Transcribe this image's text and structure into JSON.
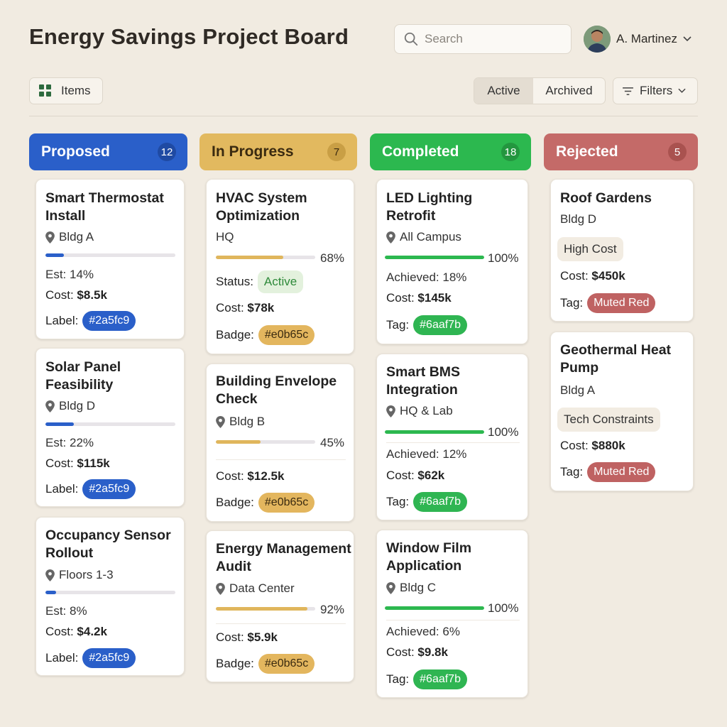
{
  "header": {
    "title": "Energy Savings Project Board",
    "search_placeholder": "Search",
    "user_name": "A. Martinez"
  },
  "toolbar": {
    "items_label": "Items",
    "view_active": "Active",
    "view_archived": "Archived",
    "filters_label": "Filters"
  },
  "colors": {
    "proposed": "#2a5fc9",
    "in_progress": "#e0b65c",
    "completed": "#6aaf7b",
    "rejected": "#c06666"
  },
  "columns": [
    {
      "title": "Proposed",
      "count": "12",
      "cards": [
        {
          "title": "Smart Thermostat Install",
          "location": "Bldg A",
          "progress": 0.14,
          "est": "Est: 14%",
          "cost_label": "Cost:",
          "cost": "$8.5k",
          "label_label": "Label:",
          "label": "#2a5fc9"
        },
        {
          "title": "Solar Panel Feasibility",
          "location": "Bldg D",
          "progress": 0.22,
          "est": "Est: 22%",
          "cost_label": "Cost:",
          "cost": "$115k",
          "label_label": "Label:",
          "label": "#2a5fc9"
        },
        {
          "title": "Occupancy Sensor Rollout",
          "location": "Floors 1-3",
          "progress": 0.08,
          "est": "Est: 8%",
          "cost_label": "Cost:",
          "cost": "$4.2k",
          "label_label": "Label:",
          "label": "#2a5fc9"
        }
      ]
    },
    {
      "title": "In Progress",
      "count": "7",
      "cards": [
        {
          "title": "HVAC System Optimization",
          "location": "HQ",
          "progress": 0.68,
          "pct": "68%",
          "status_label": "Status:",
          "status": "Active",
          "cost_label": "Cost:",
          "cost": "$78k",
          "badge_label": "Badge:",
          "badge": "#e0b65c"
        },
        {
          "title": "Building Envelope Check",
          "location": "Bldg B",
          "progress": 0.45,
          "pct": "45%",
          "cost_label": "Cost:",
          "cost": "$12.5k",
          "badge_label": "Badge:",
          "badge": "#e0b65c"
        },
        {
          "title": "Energy Management Audit",
          "location": "Data Center",
          "progress": 0.92,
          "pct": "92%",
          "cost_label": "Cost:",
          "cost": "$5.9k",
          "badge_label": "Badge:",
          "badge": "#e0b65c"
        }
      ]
    },
    {
      "title": "Completed",
      "count": "18",
      "cards": [
        {
          "title": "LED Lighting Retrofit",
          "location": "All Campus",
          "progress": 1.0,
          "pct": "100%",
          "achieved": "Achieved: 18%",
          "cost_label": "Cost:",
          "cost": "$145k",
          "tag_label": "Tag:",
          "tag": "#6aaf7b"
        },
        {
          "title": "Smart BMS Integration",
          "location": "HQ & Lab",
          "progress": 1.0,
          "pct": "100%",
          "achieved": "Achieved: 12%",
          "cost_label": "Cost:",
          "cost": "$62k",
          "tag_label": "Tag:",
          "tag": "#6aaf7b"
        },
        {
          "title": "Window Film Application",
          "location": "Bldg C",
          "progress": 1.0,
          "pct": "100%",
          "achieved": "Achieved: 6%",
          "cost_label": "Cost:",
          "cost": "$9.8k",
          "tag_label": "Tag:",
          "tag": "#6aaf7b"
        }
      ]
    },
    {
      "title": "Rejected",
      "count": "5",
      "cards": [
        {
          "title": "Roof Gardens",
          "location": "Bldg D",
          "reason": "High Cost",
          "cost_label": "Cost:",
          "cost": "$450k",
          "tag_label": "Tag:",
          "tag": "Muted Red"
        },
        {
          "title": "Geothermal Heat Pump",
          "location": "Bldg A",
          "reason": "Tech Constraints",
          "cost_label": "Cost:",
          "cost": "$880k",
          "tag_label": "Tag:",
          "tag": "Muted Red"
        }
      ]
    }
  ]
}
